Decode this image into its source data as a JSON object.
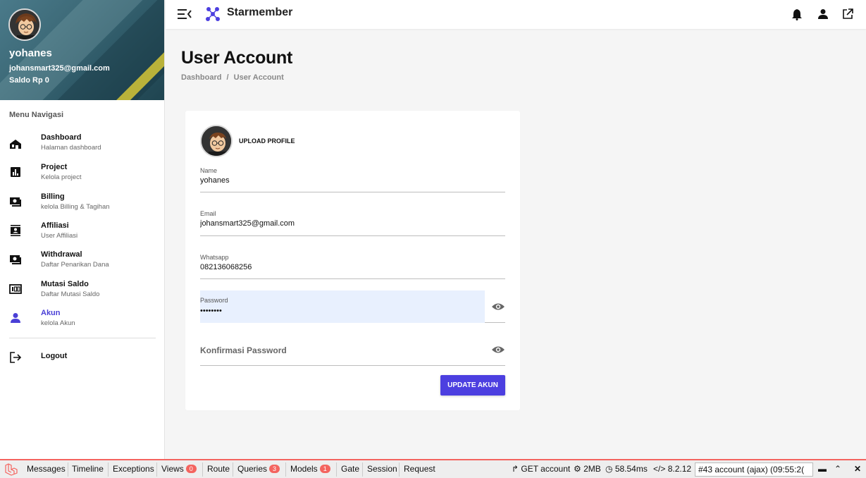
{
  "sidebar": {
    "user": {
      "name": "yohanes",
      "email": "johansmart325@gmail.com",
      "saldo": "Saldo Rp 0"
    },
    "menu_title": "Menu Navigasi",
    "items": [
      {
        "label": "Dashboard",
        "sub": "Halaman dashboard",
        "icon": "home-icon"
      },
      {
        "label": "Project",
        "sub": "Kelola project",
        "icon": "chart-icon"
      },
      {
        "label": "Billing",
        "sub": "kelola Billing & Tagihan",
        "icon": "money-icon"
      },
      {
        "label": "Affiliasi",
        "sub": "User Affiliasi",
        "icon": "contact-icon"
      },
      {
        "label": "Withdrawal",
        "sub": "Daftar Penarikan Dana",
        "icon": "money-icon"
      },
      {
        "label": "Mutasi Saldo",
        "sub": "Daftar Mutasi Saldo",
        "icon": "pin-icon"
      },
      {
        "label": "Akun",
        "sub": "kelola Akun",
        "icon": "person-icon"
      }
    ],
    "logout": "Logout"
  },
  "topbar": {
    "brand": "Starmember",
    "accent": "#4c3fe0"
  },
  "page": {
    "title": "User Account",
    "breadcrumb": [
      "Dashboard",
      "/",
      "User Account"
    ]
  },
  "form": {
    "upload_label": "UPLOAD PROFILE",
    "name": {
      "label": "Name",
      "value": "yohanes"
    },
    "email": {
      "label": "Email",
      "value": "johansmart325@gmail.com"
    },
    "whatsapp": {
      "label": "Whatsapp",
      "value": "082136068256"
    },
    "password": {
      "label": "Password",
      "value": "••••••••"
    },
    "confirm": {
      "placeholder": "Konfirmasi Password"
    },
    "submit": "UPDATE AKUN"
  },
  "debugbar": {
    "tabs": [
      "Messages",
      "Timeline",
      "Exceptions",
      "Views",
      "Route",
      "Queries",
      "Models",
      "Gate",
      "Session",
      "Request"
    ],
    "views_count": "0",
    "queries_count": "3",
    "models_count": "1",
    "method": "GET account",
    "memory": "2MB",
    "time": "58.54ms",
    "php": "8.2.12",
    "request": "#43 account (ajax) (09:55:2("
  }
}
